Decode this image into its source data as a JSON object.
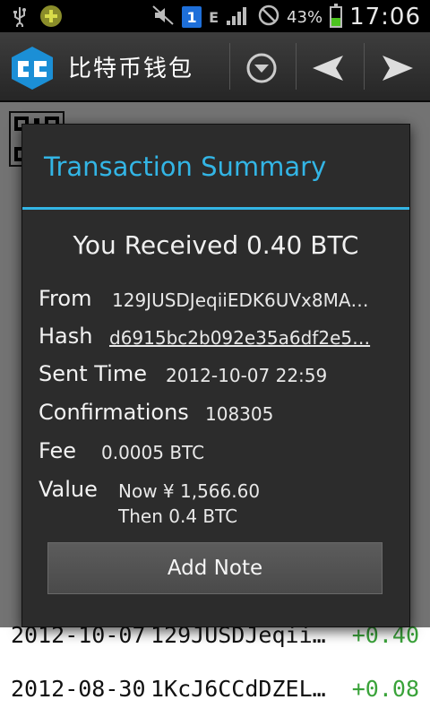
{
  "status_bar": {
    "battery_percent": "43%",
    "time": "17:06",
    "notification_count": "1",
    "network_type": "E"
  },
  "action_bar": {
    "title": "比特币钱包"
  },
  "background_rows": [
    {
      "date": "2012-10-07",
      "address": "129JUSDJeqii…",
      "amount": "+0.40"
    },
    {
      "date": "2012-08-30",
      "address": "1KcJ6CCdDZEL…",
      "amount": "+0.08"
    }
  ],
  "dialog": {
    "title": "Transaction Summary",
    "heading": "You Received 0.40 BTC",
    "from_label": "From",
    "from_value": "129JUSDJeqiiEDK6UVx8MA…",
    "hash_label": "Hash",
    "hash_value": "d6915bc2b092e35a6df2e5…",
    "sent_time_label": "Sent Time",
    "sent_time_value": "2012-10-07 22:59",
    "confirmations_label": "Confirmations",
    "confirmations_value": "108305",
    "fee_label": "Fee",
    "fee_value": "0.0005 BTC",
    "value_label": "Value",
    "value_now": "Now ¥ 1,566.60",
    "value_then": "Then 0.4 BTC",
    "add_note_label": "Add Note"
  },
  "colors": {
    "accent": "#33b5e5",
    "amount_positive": "#3aa33a",
    "dialog_bg": "#2c2c2c"
  }
}
